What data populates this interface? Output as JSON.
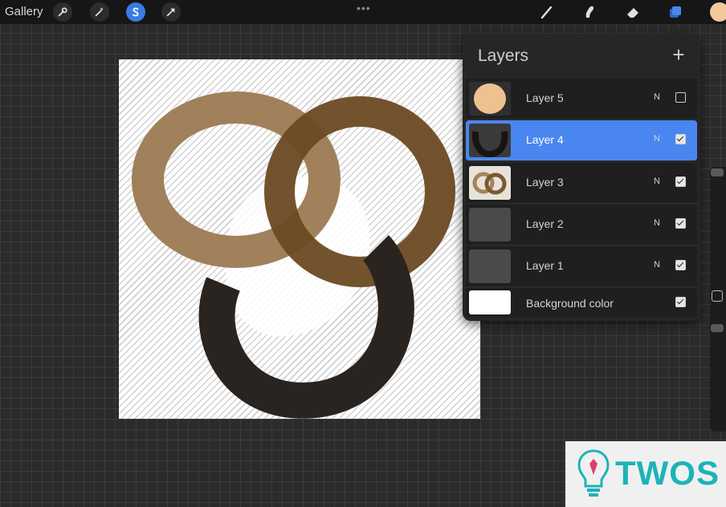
{
  "toolbar": {
    "gallery_label": "Gallery",
    "menu_dots": "•••",
    "left_tools": [
      "wrench-icon",
      "magic-wand-icon",
      "selection-s-icon",
      "transform-arrow-icon"
    ],
    "right_tools": [
      "brush-icon",
      "smudge-icon",
      "eraser-icon",
      "layers-icon"
    ],
    "accent_color": "#3b7ae6",
    "current_color": "#f1c99a"
  },
  "layers_panel": {
    "title": "Layers",
    "add_label": "+",
    "layers": [
      {
        "name": "Layer 5",
        "blend": "N",
        "visible": false,
        "selected": false
      },
      {
        "name": "Layer 4",
        "blend": "N",
        "visible": true,
        "selected": true
      },
      {
        "name": "Layer 3",
        "blend": "N",
        "visible": true,
        "selected": false
      },
      {
        "name": "Layer 2",
        "blend": "N",
        "visible": true,
        "selected": false
      },
      {
        "name": "Layer 1",
        "blend": "N",
        "visible": true,
        "selected": false
      },
      {
        "name": "Background color",
        "blend": "",
        "visible": true,
        "selected": false
      }
    ]
  },
  "canvas": {
    "colors": {
      "light_brown": "#9c7a52",
      "dark_brown": "#6b4a22",
      "black_ring": "#2a2420",
      "blob": "#ffffff"
    }
  },
  "watermark": {
    "text": "TWOS"
  }
}
